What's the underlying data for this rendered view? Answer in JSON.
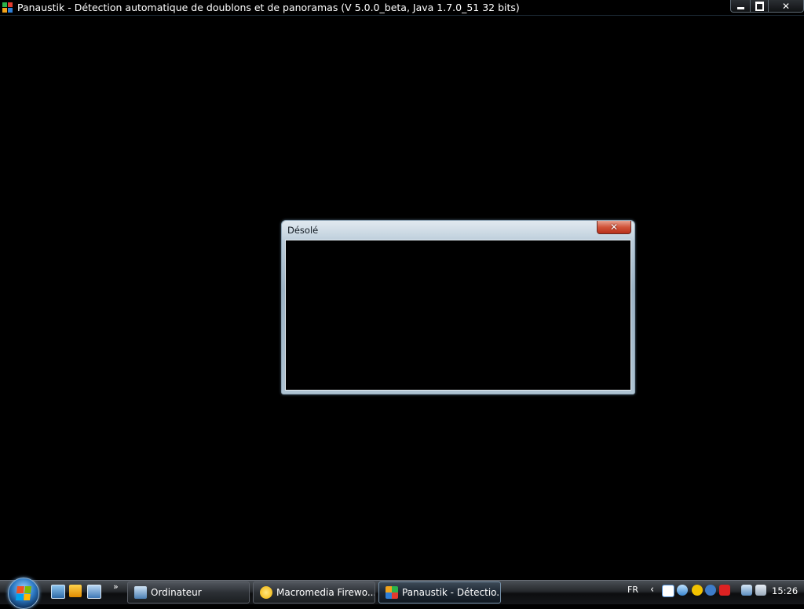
{
  "window": {
    "title": "Panaustik - Détection automatique de doublons et de panoramas (V 5.0.0_beta, Java 1.7.0_51 32 bits)",
    "controls": {
      "minimize": "minimize-icon",
      "maximize": "restore-icon",
      "close": "close-icon"
    }
  },
  "dialog": {
    "title": "Désolé",
    "close_icon": "close-icon"
  },
  "taskbar": {
    "start_icon": "windows-logo-icon",
    "quicklaunch": [
      "show-desktop-icon",
      "media-player-icon",
      "switch-windows-icon"
    ],
    "more": "»",
    "buttons": [
      {
        "label": "Ordinateur",
        "icon": "computer-icon"
      },
      {
        "label": "Macromedia Firewo...",
        "icon": "fireworks-icon"
      },
      {
        "label": "Panaustik - Détectio...",
        "icon": "panaustik-icon"
      }
    ],
    "language": "FR",
    "tray_chevron": "‹",
    "tray_icons": [
      "network-icon",
      "upload-icon",
      "update-icon",
      "aol-icon",
      "security-alert-icon",
      "display-icon",
      "volume-icon"
    ],
    "clock": "15:26"
  }
}
